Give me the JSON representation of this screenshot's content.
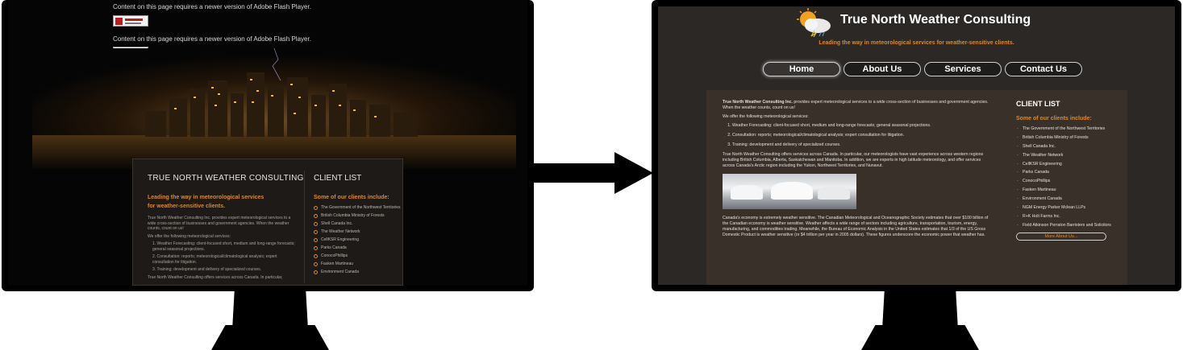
{
  "left_screen": {
    "flash_message_top": "Content on this page requires a newer version of Adobe Flash Player.",
    "flash_message": "Content on this page requires a newer version of Adobe Flash Player.",
    "panel": {
      "heading": "TRUE NORTH WEATHER CONSULTING",
      "client_heading": "CLIENT LIST",
      "tagline_line1": "Leading the way in meteorological services",
      "tagline_line2": "for weather-sensitive clients.",
      "para1": "True North Weather Consulting Inc. provides expert meteorological services to a wide cross-section of businesses and government agencies. When the weather counts, count on us!",
      "para2": "We offer the following meteorological services:",
      "services": [
        "1. Weather Forecasting: client-focused short, medium and long-range forecasts; general seasonal projections.",
        "2. Consultation: reports; meteorological/climatological analysis; expert consultation for litigation.",
        "3. Training: development and delivery of specialized courses."
      ],
      "para3": "True North Weather Consulting offers services across Canada. In particular,",
      "clients_intro": "Some of our clients include:",
      "clients": [
        "The Government of the Northwest Territories",
        "British Columbia Ministry of Forests",
        "Shell Canada Inc.",
        "The Weather Network",
        "CellKSR Engineering",
        "Parks Canada",
        "ConocoPhillips",
        "Fasken Martineau",
        "Environment Canada"
      ]
    }
  },
  "right_screen": {
    "site_title": "True North Weather Consulting",
    "logo_text": "True North Weather Consulting",
    "tagline": "Leading the way in meteorological services for weather-sensitive clients.",
    "nav": [
      "Home",
      "About Us",
      "Services",
      "Contact Us"
    ],
    "active_nav": "Home",
    "main": {
      "intro_bold": "True North Weather Consulting Inc.",
      "intro_rest": " provides expert meteorological services to a wide cross-section of businesses and government agencies. When the weather counts, count on us!",
      "offer": "We offer the following meteorological services:",
      "services": [
        "Weather Forecasting: client-focused short, medium and long-range forecasts; general seasonal projections.",
        "Consultation: reports; meteorological/climatological analysis; expert consultation for litigation.",
        "Training: development and delivery of specialized courses."
      ],
      "para_canada": "True North Weather Consulting offers services across Canada. In particular, our meteorologists have vast experience across western regions including British Columbia, Alberta, Saskatchewan and Manitoba. In addition, we are experts in high latitude meteorology, and offer services across Canada's Arctic region including the Yukon, Northwest Territories, and Nunavut.",
      "para_economy": "Canada's economy is extremely weather sensitive. The Canadian Meteorological and Oceanographic Society estimates that over $100 billion of the Canadian economy is weather sensitive. Weather affects a wide range of sectors including agriculture, transportation, tourism, energy, manufacturing, and commodities trading. Meanwhile, the Bureau of Economic Analysis in the United States estimates that 1/3 of the US Gross Domestic Product is weather sensitive (or $4 trillion per year in 2005 dollars). These figures underscore the economic power that weather has."
    },
    "sidebar": {
      "heading": "CLIENT LIST",
      "intro": "Some of our clients include:",
      "clients": [
        "The Government of the Northwest Territories",
        "British Columbia Ministry of Forests",
        "Shell Canada Inc.",
        "The Weather Network",
        "CellKSR Engineering",
        "Parks Canada",
        "ConocoPhillips",
        "Fasken Martineau",
        "Environment Canada",
        "NGM Energy Parker Mclean LLPs",
        "R+K Holt Farms Inc.",
        "Field Atkinson Perraton Barristers and Solicitors"
      ],
      "more_button": "More About Us..."
    }
  },
  "colors": {
    "accent": "#d98a2b",
    "right_bg": "#2b2826",
    "content_bg": "#3a302a"
  }
}
